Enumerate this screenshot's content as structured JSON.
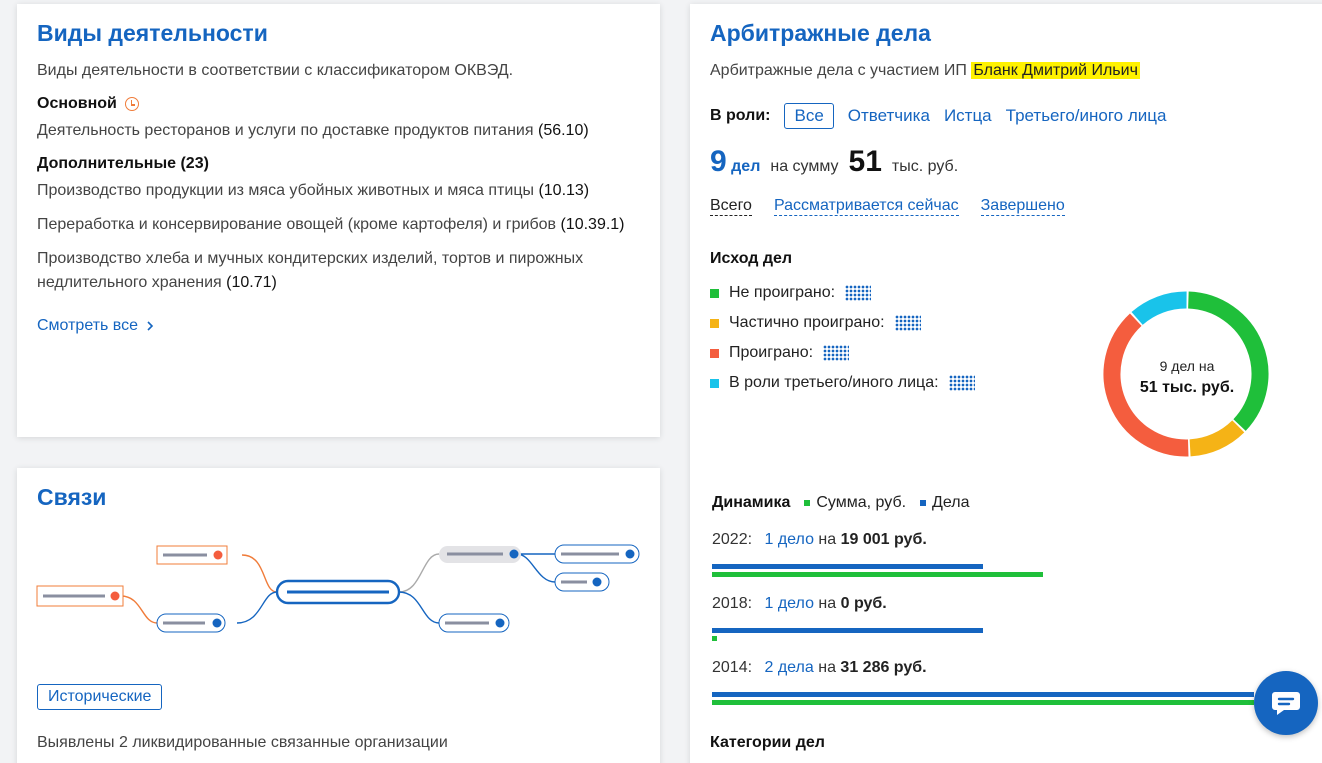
{
  "activities": {
    "title": "Виды деятельности",
    "subtitle": "Виды деятельности в соответствии с классификатором ОКВЭД.",
    "main_label": "Основной",
    "main_item": {
      "text": "Деятельность ресторанов и услуги по доставке продуктов питания",
      "code": "(56.10)"
    },
    "additional_label": "Дополнительные (23)",
    "items": [
      {
        "text": "Производство продукции из мяса убойных животных и мяса птицы",
        "code": "(10.13)"
      },
      {
        "text": "Переработка и консервирование овощей (кроме картофеля) и грибов",
        "code": "(10.39.1)"
      },
      {
        "text": "Производство хлеба и мучных кондитерских изделий, тортов и пирожных недлительного хранения",
        "code": "(10.71)"
      }
    ],
    "see_all": "Смотреть все"
  },
  "relations": {
    "title": "Связи",
    "historic_button": "Исторические",
    "note": "Выявлены 2 ликвидированные связанные организации"
  },
  "arbitration": {
    "title": "Арбитражные дела",
    "subtitle_prefix": "Арбитражные дела с участием ИП",
    "subject_name": "Бланк Дмитрий Ильич",
    "roles_label": "В роли:",
    "roles": [
      "Все",
      "Ответчика",
      "Истца",
      "Третьего/иного лица"
    ],
    "count": "9",
    "count_unit": "дел",
    "sum_prefix": "на сумму",
    "sum_value": "51",
    "sum_unit": "тыс. руб.",
    "filters": [
      "Всего",
      "Рассматривается сейчас",
      "Завершено"
    ],
    "outcome_title": "Исход дел",
    "outcomes": [
      {
        "label": "Не проиграно:",
        "color": "#1fbf3a",
        "share": 0.37
      },
      {
        "label": "Частично проиграно:",
        "color": "#f5b316",
        "share": 0.12
      },
      {
        "label": "Проиграно:",
        "color": "#f45d3e",
        "share": 0.39
      },
      {
        "label": "В роли третьего/иного лица:",
        "color": "#19c3ea",
        "share": 0.12
      }
    ],
    "donut_line1": "9 дел на",
    "donut_line2": "51 тыс. руб.",
    "dynamics_title": "Динамика",
    "dynamics_sum_label": "Сумма, руб.",
    "dynamics_cases_label": "Дела",
    "years": [
      {
        "year": "2022:",
        "cases": "1 дело",
        "on": "на",
        "sum": "19 001 руб.",
        "cases_share": 0.5,
        "sum_share": 0.61
      },
      {
        "year": "2018:",
        "cases": "1 дело",
        "on": "на",
        "sum": "0 руб.",
        "cases_share": 0.5,
        "sum_share": 0.01
      },
      {
        "year": "2014:",
        "cases": "2 дела",
        "on": "на",
        "sum": "31 286 руб.",
        "cases_share": 1.0,
        "sum_share": 1.0
      }
    ],
    "categories_title": "Категории дел"
  },
  "colors": {
    "accent": "#1565c0",
    "green": "#1fbf3a",
    "orange": "#f45d3e",
    "highlight": "#fff200"
  },
  "icons": {
    "clock": "clock-icon",
    "chevron": "chevron-right-icon",
    "chat": "chat-icon"
  }
}
